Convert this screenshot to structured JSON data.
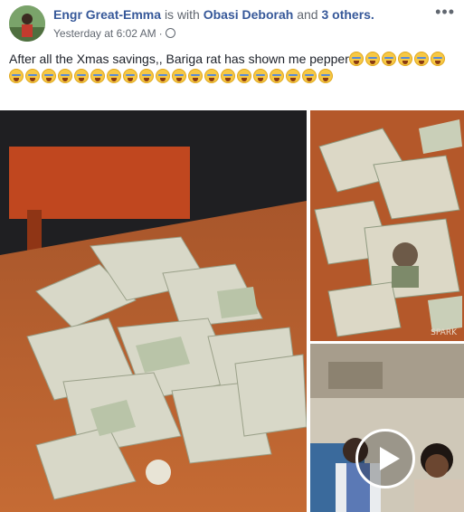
{
  "post": {
    "author": "Engr Great-Emma",
    "with_text": "is with",
    "tagged_person": "Obasi Deborah",
    "and_text": "and",
    "others": "3 others.",
    "timestamp": "Yesterday at 6:02 AM",
    "privacy_icon": "globe-icon",
    "more_icon": "more-dots-icon",
    "more_label": "•••",
    "body_text": "After all the Xmas savings,, Bariga rat has shown me pepper",
    "emoji_icon": "loudly-crying-face-icon",
    "emoji_count": 26
  },
  "photos": {
    "watermark": "SPARK"
  },
  "colors": {
    "link": "#365899",
    "meta": "#616770",
    "text": "#1d2129"
  }
}
